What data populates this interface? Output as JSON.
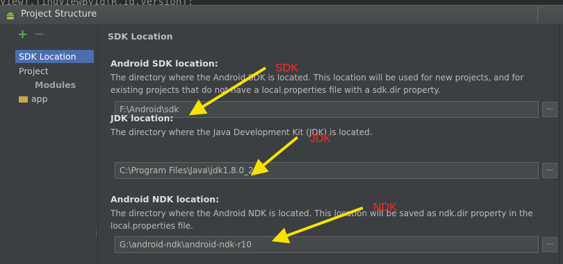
{
  "background_code": "View).findViewById(R.id.version);",
  "window": {
    "title": "Project Structure"
  },
  "sidebar": {
    "add_label": "+",
    "remove_label": "−",
    "items": [
      {
        "label": "SDK Location",
        "selected": true
      },
      {
        "label": "Project",
        "selected": false
      }
    ],
    "modules_header": "Modules",
    "modules": [
      {
        "label": "app",
        "icon": "folder-icon"
      }
    ]
  },
  "content": {
    "section_title": "SDK Location",
    "android_sdk": {
      "label": "Android SDK location:",
      "description": "The directory where the Android SDK is located. This location will be used for new projects, and for existing projects that do not have a local.properties file with a sdk.dir property.",
      "path": "F:\\Android\\sdk",
      "browse_label": "..."
    },
    "jdk": {
      "label": "JDK location:",
      "description": "The directory where the Java Development Kit (JDK) is located.",
      "path": "C:\\Program Files\\Java\\jdk1.8.0_25",
      "browse_label": "..."
    },
    "android_ndk": {
      "label": "Android NDK location:",
      "description": "The directory where the Android NDK is located. This location will be saved as ndk.dir property in the local.properties file.",
      "path": "G:\\android-ndk\\android-ndk-r10",
      "browse_label": "..."
    }
  },
  "annotations": {
    "sdk": "SDK",
    "jdk": "JDK",
    "ndk": "NDK",
    "color": "#ff2a2a",
    "arrow_color": "#f5e400"
  },
  "colors": {
    "selection": "#4b6eaf",
    "background": "#3c3f41",
    "field": "#45494a"
  }
}
